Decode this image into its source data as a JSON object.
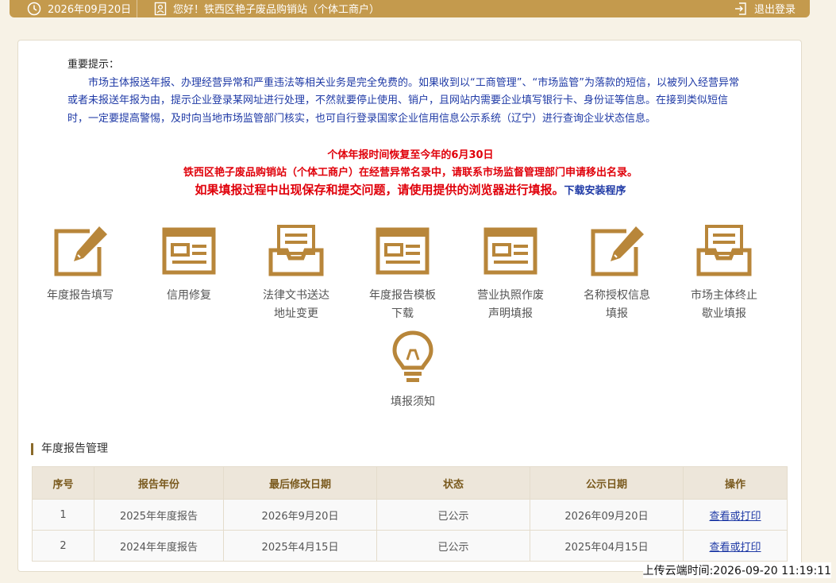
{
  "topbar": {
    "date": "2026年09月20日",
    "greeting": "您好！铁西区艳子废品购销站（个体工商户）",
    "logout_label": "退出登录"
  },
  "notice": {
    "heading": "重要提示：",
    "body": "市场主体报送年报、办理经营异常和严重违法等相关业务是完全免费的。如果收到以“工商管理”、“市场监管”为落款的短信，以被列入经营异常或者未报送年报为由，提示企业登录某网址进行处理，不然就要停止使用、销户，且网站内需要企业填写银行卡、身份证等信息。在接到类似短信时，一定要提高警惕，及时向当地市场监管部门核实，也可自行登录国家企业信用信息公示系统（辽宁）进行查询企业状态信息。",
    "alert_deadline": "个体年报时间恢复至今年的6月30日",
    "alert_abnormal": "铁西区艳子废品购销站（个体工商户）在经营异常名录中，请联系市场监督管理部门申请移出名录。",
    "alert_browser": "如果填报过程中出现保存和提交问题，请使用提供的浏览器进行填报。",
    "download_label": "下载安装程序"
  },
  "tiles": [
    {
      "line1": "年度报告填写",
      "line2": "",
      "icon": "edit-pen-icon"
    },
    {
      "line1": "信用修复",
      "line2": "",
      "icon": "form-window-icon"
    },
    {
      "line1": "法律文书送达",
      "line2": "地址变更",
      "icon": "inbox-tray-icon"
    },
    {
      "line1": "年度报告模板",
      "line2": "下载",
      "icon": "form-window-icon"
    },
    {
      "line1": "营业执照作废",
      "line2": "声明填报",
      "icon": "form-window-icon"
    },
    {
      "line1": "名称授权信息",
      "line2": "填报",
      "icon": "edit-pen-icon"
    },
    {
      "line1": "市场主体终止",
      "line2": "歇业填报",
      "icon": "inbox-tray-icon"
    },
    {
      "line1": "填报须知",
      "line2": "",
      "icon": "lightbulb-icon"
    }
  ],
  "section_title": "年度报告管理",
  "table": {
    "headers": [
      "序号",
      "报告年份",
      "最后修改日期",
      "状态",
      "公示日期",
      "操作"
    ],
    "rows": [
      [
        "1",
        "2025年年度报告",
        "2026年9月20日",
        "已公示",
        "2026年09月20日",
        "查看或打印"
      ],
      [
        "2",
        "2024年年度报告",
        "2025年4月15日",
        "已公示",
        "2025年04月15日",
        "查看或打印"
      ]
    ]
  },
  "upload_time": "上传云端时间:2026-09-20 11:19:11",
  "colors": {
    "brand_gold": "#c49a4d",
    "icon_gold": "#b8863a",
    "notice_blue": "#1f3aa6",
    "alert_red": "#e0000a"
  }
}
